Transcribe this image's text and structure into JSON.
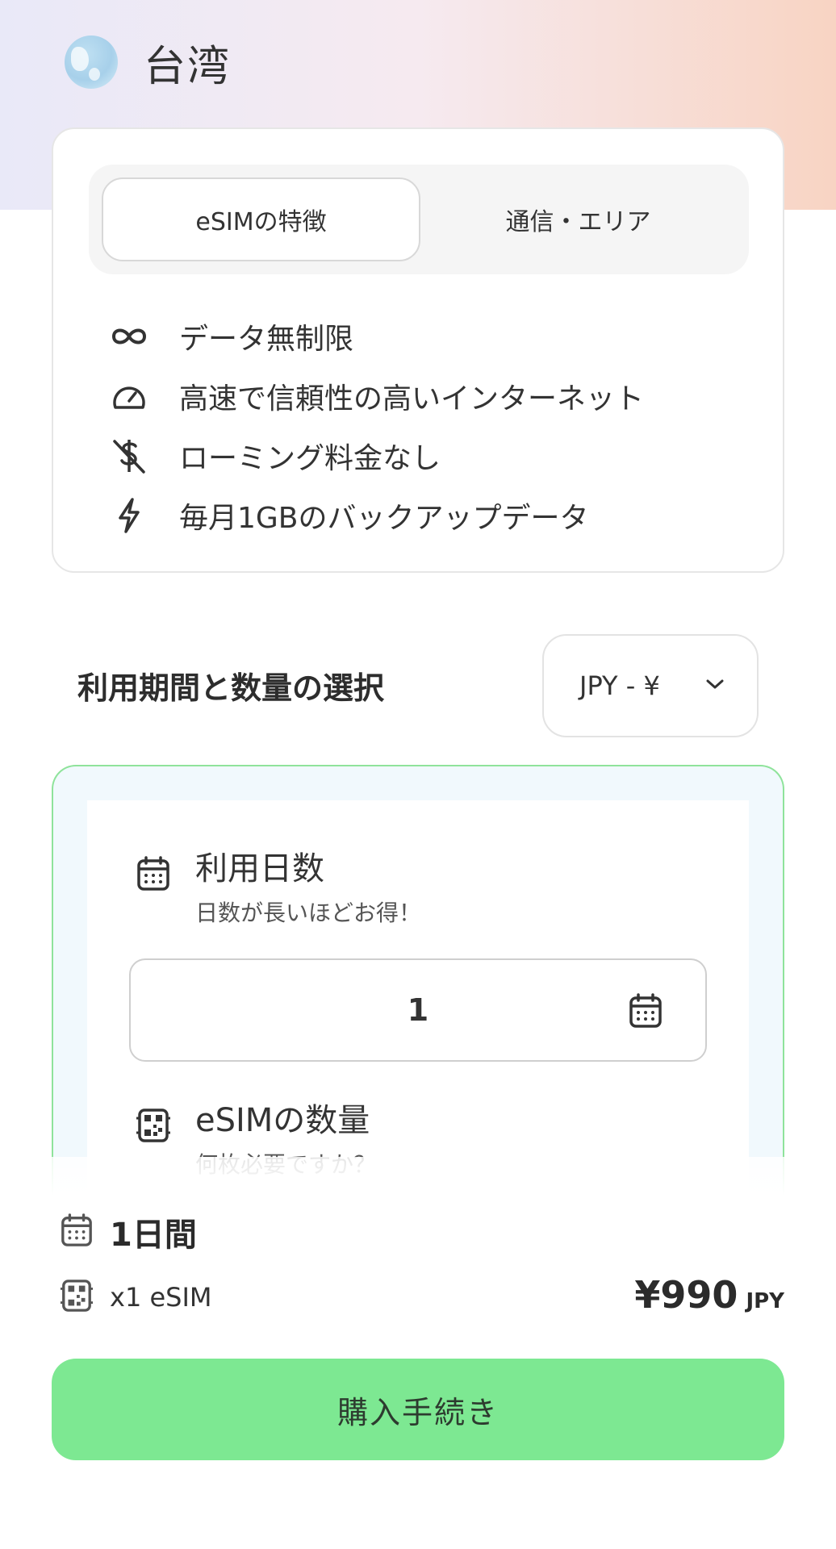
{
  "header": {
    "country": "台湾"
  },
  "tabs": [
    {
      "label": "eSIMの特徴",
      "active": true
    },
    {
      "label": "通信・エリア",
      "active": false
    }
  ],
  "features": [
    {
      "icon": "infinity-icon",
      "text": "データ無制限"
    },
    {
      "icon": "speedometer-icon",
      "text": "高速で信頼性の高いインターネット"
    },
    {
      "icon": "no-roaming-icon",
      "text": "ローミング料金なし"
    },
    {
      "icon": "lightning-icon",
      "text": "毎月1GBのバックアップデータ"
    }
  ],
  "selection": {
    "title": "利用期間と数量の選択",
    "currency": "JPY - ¥"
  },
  "plan": {
    "days_title": "利用日数",
    "days_subtitle": "日数が長いほどお得！",
    "days_value": "1",
    "quantity_title": "eSIMの数量",
    "quantity_subtitle": "何枚必要ですか？"
  },
  "summary": {
    "days": "1日間",
    "esim": "x1 eSIM",
    "price": "¥990",
    "currency": "JPY"
  },
  "buy_button": "購入手続き",
  "colors": {
    "accent_green": "#7de892",
    "card_border_green": "#8fe39b"
  }
}
